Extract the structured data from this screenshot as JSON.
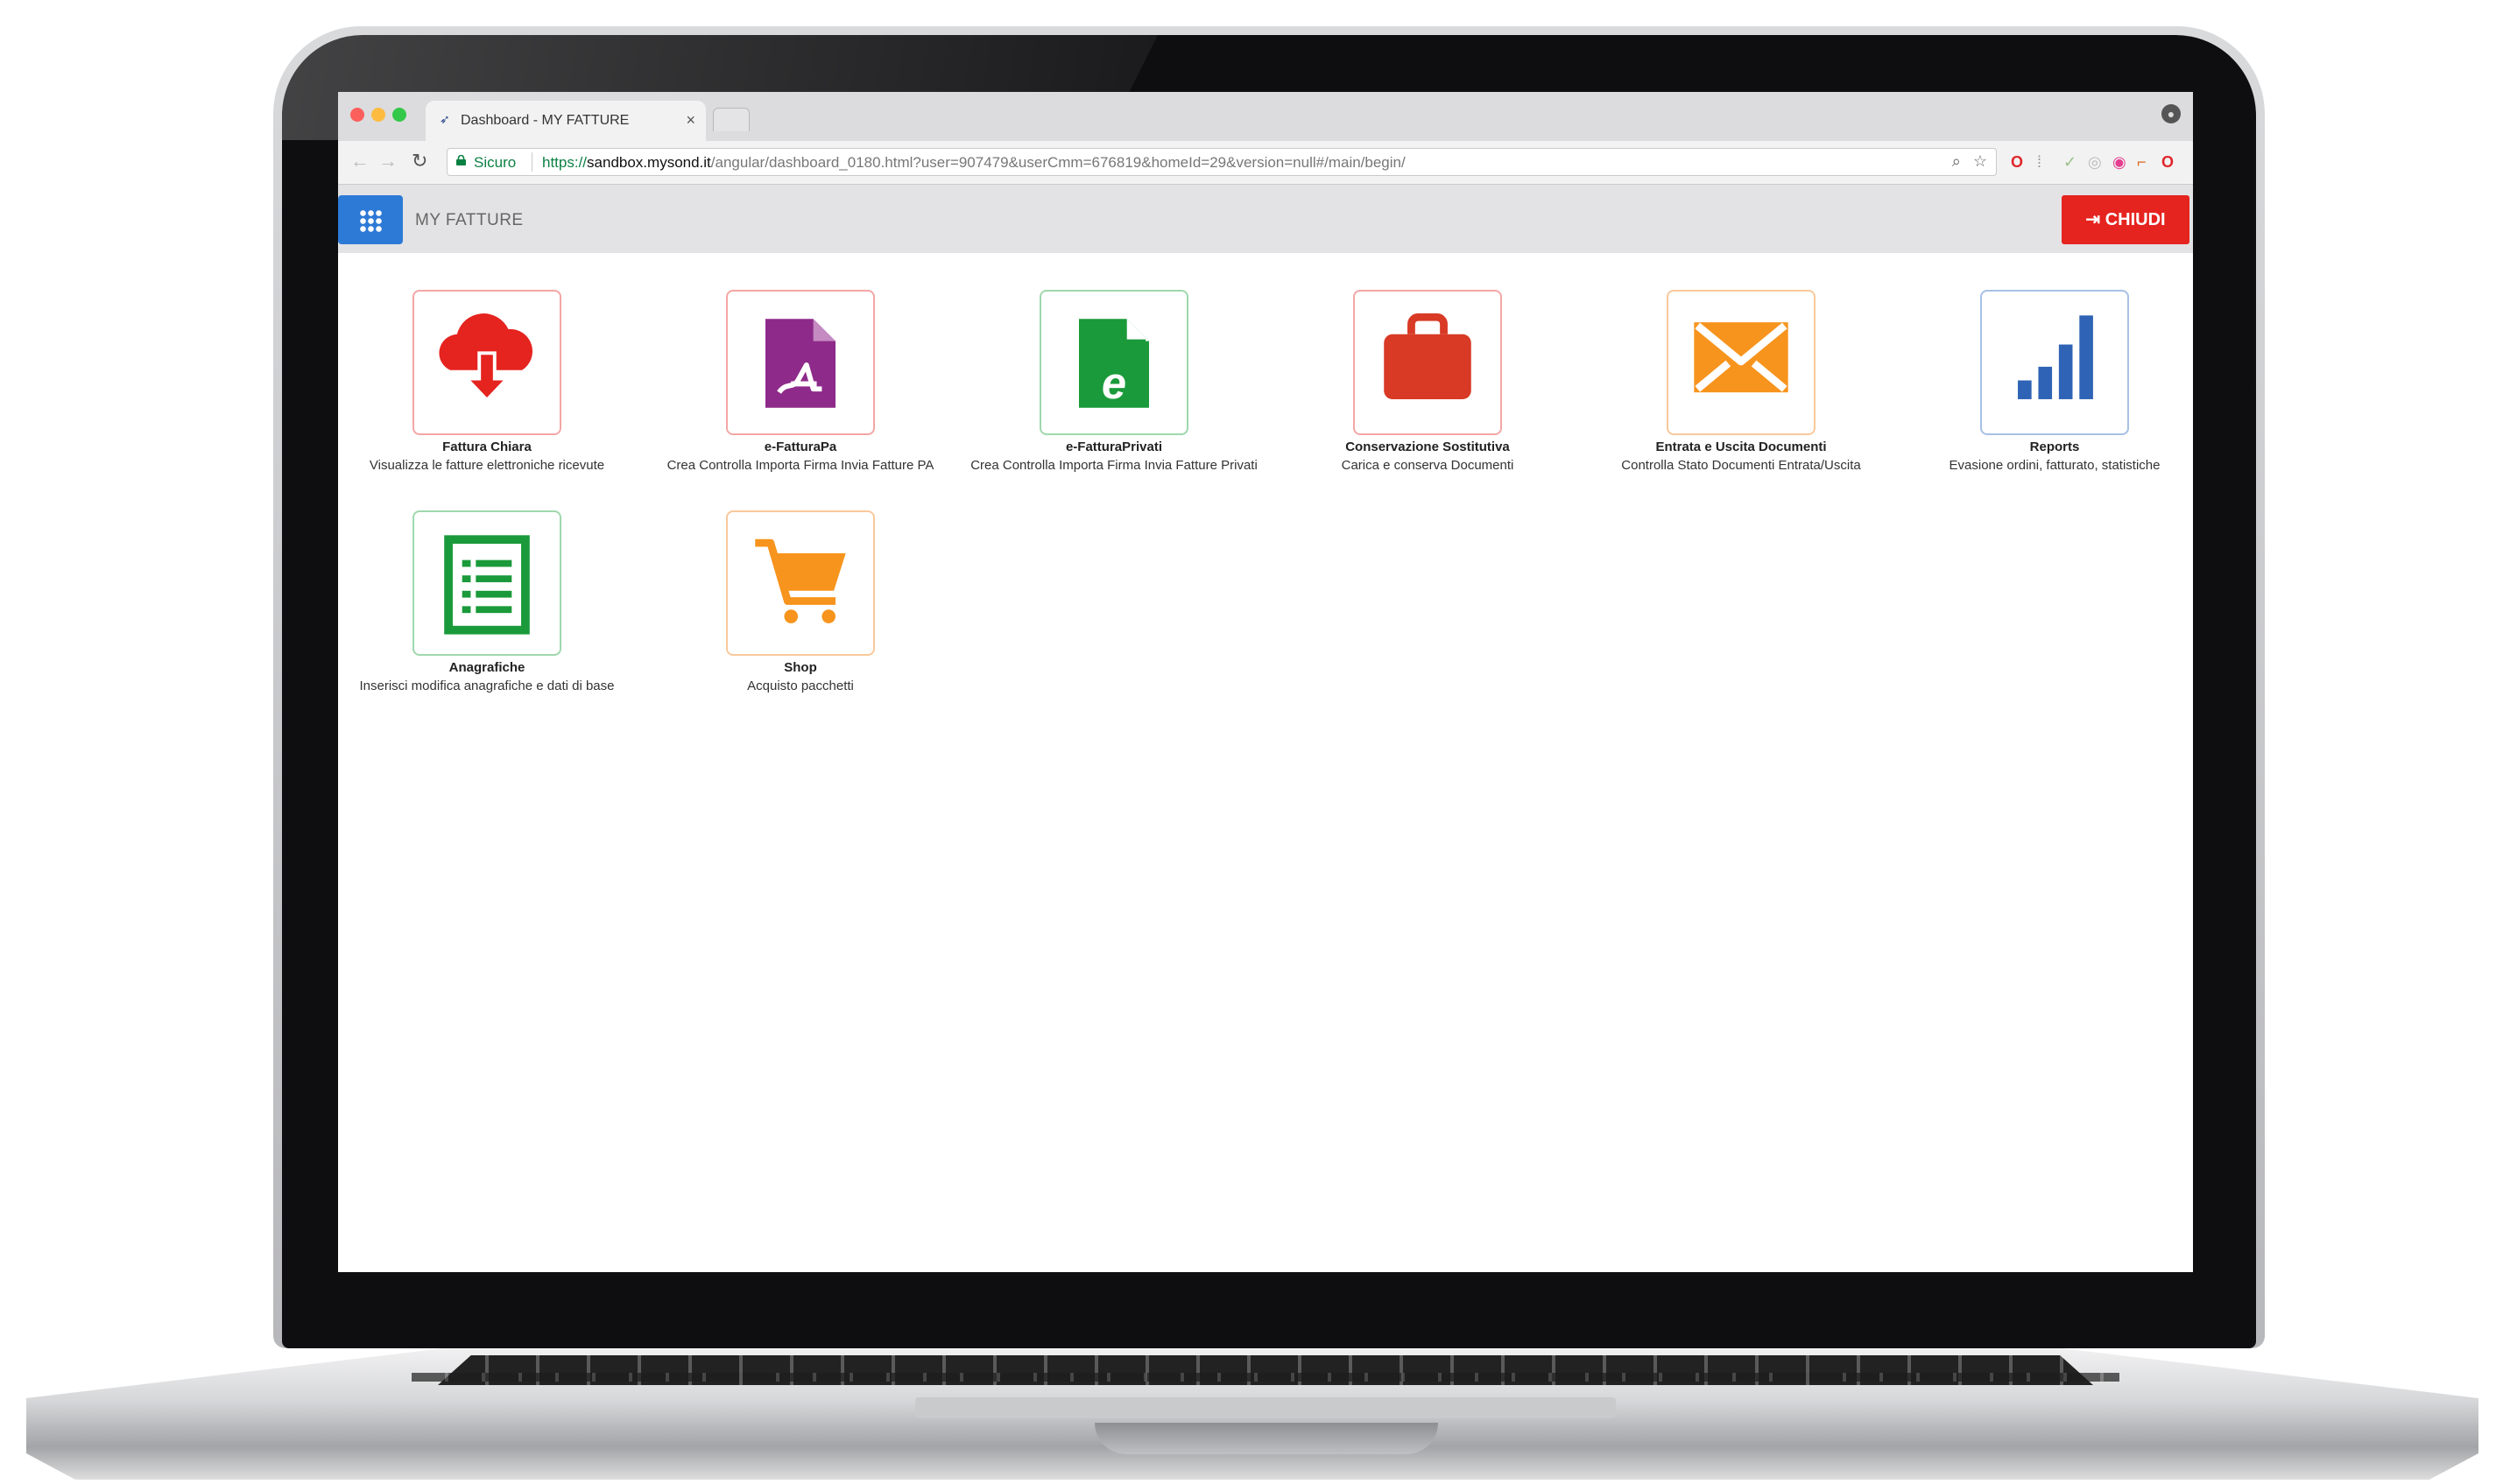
{
  "browser": {
    "tab_title": "Dashboard - MY FATTURE",
    "tab_close": "×",
    "secure_label": "Sicuro",
    "url_scheme": "https://",
    "url_host": "sandbox.mysond.it",
    "url_path": "/angular/dashboard_0180.html?user=907479&userCmm=676819&homeId=29&version=null#/main/begin/"
  },
  "header": {
    "app_title": "MY FATTURE",
    "close_label": "CHIUDI"
  },
  "tiles": [
    {
      "title": "Fattura Chiara",
      "desc": "Visualizza le fatture elettroniche ricevute",
      "icon": "cloud-download-icon",
      "color": "#e5231f"
    },
    {
      "title": "e-FatturaPa",
      "desc": "Crea Controlla Importa Firma Invia Fatture PA",
      "icon": "document-signature-icon",
      "color": "#8e2a8a"
    },
    {
      "title": "e-FatturaPrivati",
      "desc": "Crea Controlla Importa Firma Invia Fatture Privati",
      "icon": "document-e-icon",
      "color": "#1a9a3a"
    },
    {
      "title": "Conservazione Sostitutiva",
      "desc": "Carica e conserva Documenti",
      "icon": "briefcase-icon",
      "color": "#d83a25"
    },
    {
      "title": "Entrata e Uscita Documenti",
      "desc": "Controlla Stato Documenti Entrata/Uscita",
      "icon": "envelope-icon",
      "color": "#f7941d"
    },
    {
      "title": "Reports",
      "desc": "Evasione ordini, fatturato, statistiche",
      "icon": "bar-chart-icon",
      "color": "#2f63b5"
    },
    {
      "title": "Anagrafiche",
      "desc": "Inserisci modifica anagrafiche e dati di base",
      "icon": "list-icon",
      "color": "#1a9a3a"
    },
    {
      "title": "Shop",
      "desc": "Acquisto pacchetti",
      "icon": "shopping-cart-icon",
      "color": "#f7941d"
    }
  ]
}
